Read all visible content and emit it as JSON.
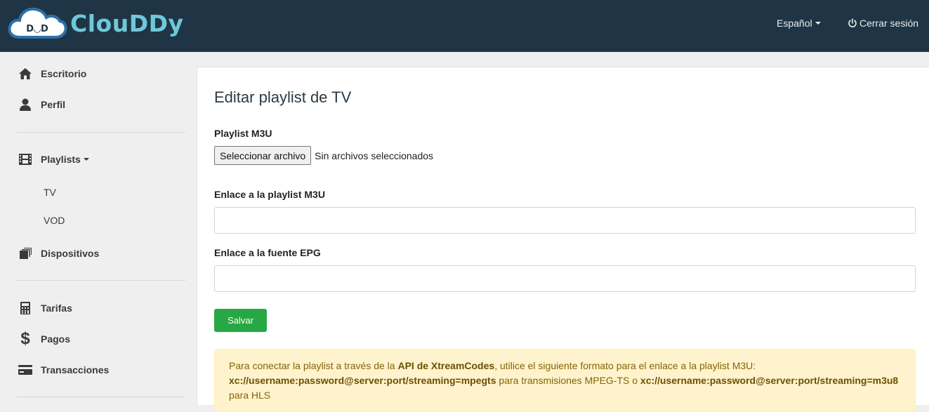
{
  "header": {
    "logo_badge": "D◡D",
    "logo_text": "ClouDDy",
    "language": "Español",
    "logout": "Cerrar sesión"
  },
  "sidebar": {
    "items": [
      {
        "label": "Escritorio",
        "icon": "home-icon"
      },
      {
        "label": "Perfil",
        "icon": "user-icon"
      },
      {
        "label": "Playlists",
        "icon": "film-icon"
      },
      {
        "label": "Dispositivos",
        "icon": "devices-icon"
      },
      {
        "label": "Tarifas",
        "icon": "calculator-icon"
      },
      {
        "label": "Pagos",
        "icon": "dollar-icon"
      },
      {
        "label": "Transacciones",
        "icon": "credit-card-icon"
      }
    ],
    "playlist_sub": [
      "TV",
      "VOD"
    ]
  },
  "main": {
    "title": "Editar playlist de TV",
    "m3u_label": "Playlist M3U",
    "file_button": "Seleccionar archivo",
    "file_status": "Sin archivos seleccionados",
    "m3u_link_label": "Enlace a la playlist M3U",
    "m3u_link_value": "",
    "epg_label": "Enlace a la fuente EPG",
    "epg_value": "",
    "save": "Salvar",
    "alert": {
      "t1": "Para conectar la playlist a través de la ",
      "b1": "API de XtreamCodes",
      "t2": ", utilice el siguiente formato para el enlace a la playlist M3U: ",
      "b2": "xc://username:password@server:port/streaming=mpegts",
      "t3": " para transmisiones MPEG-TS o ",
      "b3": "xc://username:password@server:port/streaming=m3u8",
      "t4": " para HLS"
    }
  },
  "colors": {
    "header_bg": "#1f3545",
    "logo": "#6ec8d9",
    "success": "#28a745",
    "alert_bg": "#fff3cd",
    "alert_text": "#856404"
  }
}
